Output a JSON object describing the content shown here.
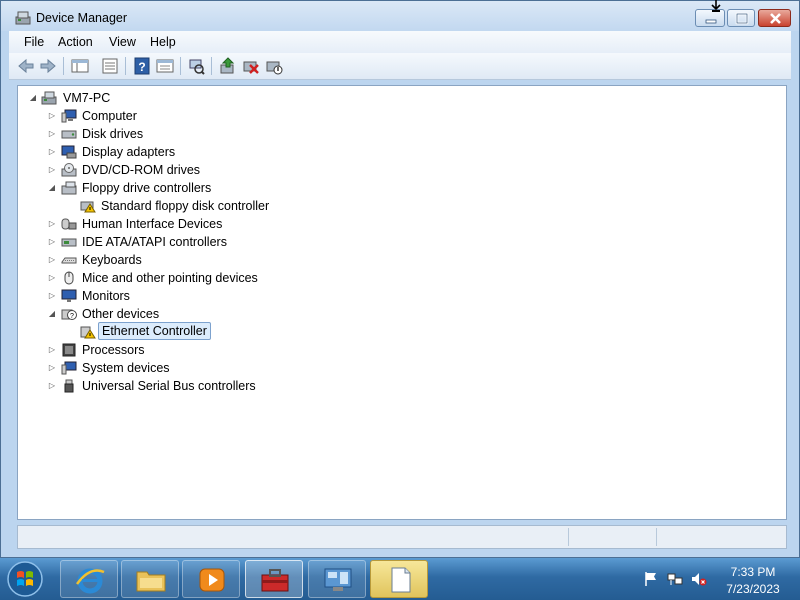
{
  "window": {
    "title": "Device Manager"
  },
  "menubar": {
    "items": [
      "File",
      "Action",
      "View",
      "Help"
    ]
  },
  "toolbar": {
    "icons": [
      "back-icon",
      "forward-icon",
      "show-hide-tree-icon",
      "properties-icon",
      "help-icon",
      "view-icon",
      "scan-hardware-icon",
      "update-driver-icon",
      "uninstall-icon",
      "disable-icon"
    ]
  },
  "tree": {
    "root": "VM7-PC",
    "nodes": [
      {
        "label": "Computer",
        "expanded": false
      },
      {
        "label": "Disk drives",
        "expanded": false
      },
      {
        "label": "Display adapters",
        "expanded": false
      },
      {
        "label": "DVD/CD-ROM drives",
        "expanded": false
      },
      {
        "label": "Floppy drive controllers",
        "expanded": true
      },
      {
        "label": "Standard floppy disk controller",
        "child": true,
        "warning": true
      },
      {
        "label": "Human Interface Devices",
        "expanded": false
      },
      {
        "label": "IDE ATA/ATAPI controllers",
        "expanded": false
      },
      {
        "label": "Keyboards",
        "expanded": false
      },
      {
        "label": "Mice and other pointing devices",
        "expanded": false
      },
      {
        "label": "Monitors",
        "expanded": false
      },
      {
        "label": "Other devices",
        "expanded": true
      },
      {
        "label": "Ethernet Controller",
        "child": true,
        "warning": true,
        "selected": true
      },
      {
        "label": "Processors",
        "expanded": false
      },
      {
        "label": "System devices",
        "expanded": false
      },
      {
        "label": "Universal Serial Bus controllers",
        "expanded": false
      }
    ]
  },
  "taskbar": {
    "apps": [
      "internet-explorer",
      "windows-explorer",
      "media-player",
      "device-manager-toolbox",
      "control-panel",
      "notepad"
    ],
    "clock": {
      "time": "7:33 PM",
      "date": "7/23/2023"
    }
  },
  "colors": {
    "selection": "#dcecfc",
    "taskbar": "#2f6aa3",
    "warning": "#f5c400"
  }
}
